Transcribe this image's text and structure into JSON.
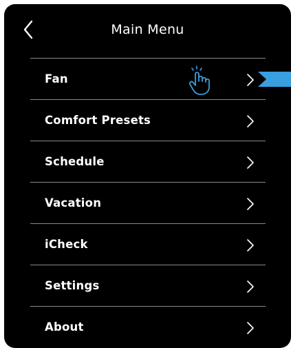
{
  "header": {
    "title": "Main Menu",
    "back_icon": "chevron-left-icon"
  },
  "menu": {
    "items": [
      {
        "label": "Fan",
        "icon": "chevron-right-icon"
      },
      {
        "label": "Comfort Presets",
        "icon": "chevron-right-icon"
      },
      {
        "label": "Schedule",
        "icon": "chevron-right-icon"
      },
      {
        "label": "Vacation",
        "icon": "chevron-right-icon"
      },
      {
        "label": "iCheck",
        "icon": "chevron-right-icon"
      },
      {
        "label": "Settings",
        "icon": "chevron-right-icon"
      },
      {
        "label": "About",
        "icon": "chevron-right-icon"
      }
    ]
  },
  "annotations": {
    "hand_icon": "tap-hand-icon",
    "pointer_tab_icon": "pointer-tab-icon"
  },
  "colors": {
    "background": "#000000",
    "text": "#ffffff",
    "divider": "#8a8a8a",
    "accent": "#3a9fde"
  }
}
